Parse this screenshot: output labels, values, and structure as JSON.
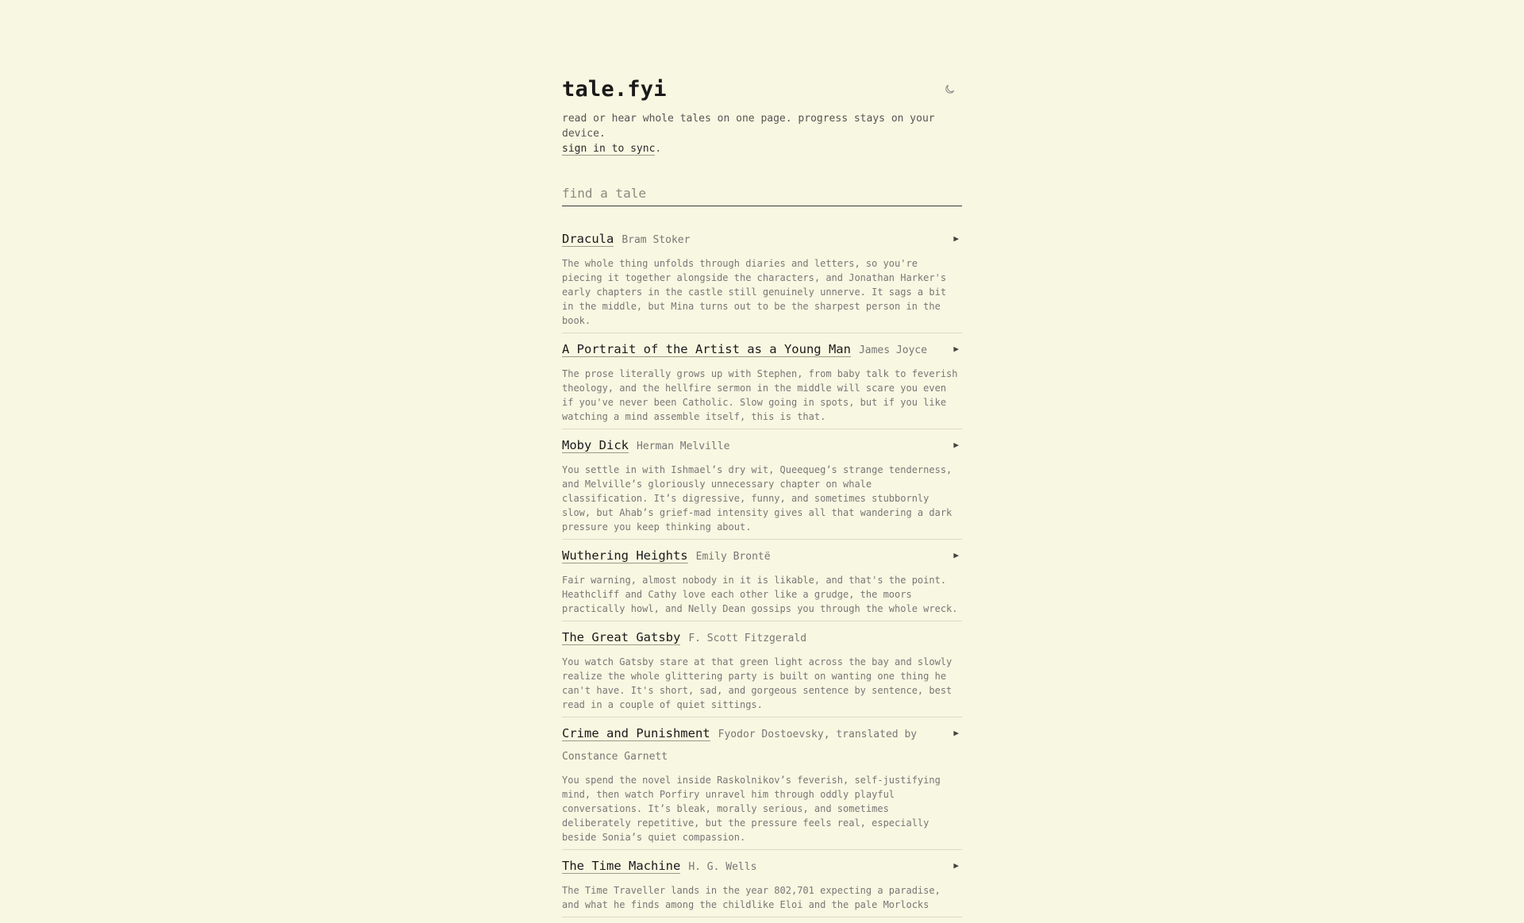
{
  "site": {
    "title": "tale.fyi",
    "tagline": "read or hear whole tales on one page. progress stays on your device.",
    "sync_link": "sign in to sync",
    "sync_suffix": "."
  },
  "theme_toggle": {
    "icon": "moon-icon"
  },
  "search": {
    "placeholder": "find a tale",
    "value": ""
  },
  "tales": [
    {
      "title": "Dracula",
      "author": "Bram Stoker",
      "play": "▶",
      "description": "The whole thing unfolds through diaries and letters, so you're piecing it together alongside the characters, and Jonathan Harker's early chapters in the castle still genuinely unnerve. It sags a bit in the middle, but Mina turns out to be the sharpest person in the book."
    },
    {
      "title": "A Portrait of the Artist as a Young Man",
      "author": "James Joyce",
      "play": "▶",
      "description": "The prose literally grows up with Stephen, from baby talk to feverish theology, and the hellfire sermon in the middle will scare you even if you've never been Catholic. Slow going in spots, but if you like watching a mind assemble itself, this is that."
    },
    {
      "title": "Moby Dick",
      "author": "Herman Melville",
      "play": "▶",
      "description": "You settle in with Ishmael’s dry wit, Queequeg’s strange tenderness, and Melville’s gloriously unnecessary chapter on whale classification. It’s digressive, funny, and sometimes stubbornly slow, but Ahab’s grief-mad intensity gives all that wandering a dark pressure you keep thinking about."
    },
    {
      "title": "Wuthering Heights",
      "author": "Emily Brontë",
      "play": "▶",
      "description": "Fair warning, almost nobody in it is likable, and that's the point. Heathcliff and Cathy love each other like a grudge, the moors practically howl, and Nelly Dean gossips you through the whole wreck."
    },
    {
      "title": "The Great Gatsby",
      "author": "F. Scott Fitzgerald",
      "play": "",
      "description": "You watch Gatsby stare at that green light across the bay and slowly realize the whole glittering party is built on wanting one thing he can't have. It's short, sad, and gorgeous sentence by sentence, best read in a couple of quiet sittings."
    },
    {
      "title": "Crime and Punishment",
      "author": "Fyodor Dostoevsky, translated by Constance Garnett",
      "play": "▶",
      "description": "You spend the novel inside Raskolnikov’s feverish, self-justifying mind, then watch Porfiry unravel him through oddly playful conversations. It’s bleak, morally serious, and sometimes deliberately repetitive, but the pressure feels real, especially beside Sonia’s quiet compassion."
    },
    {
      "title": "The Time Machine",
      "author": "H. G. Wells",
      "play": "▶",
      "description": "The Time Traveller lands in the year 802,701 expecting a paradise, and what he finds among the childlike Eloi and the pale Morlocks"
    }
  ]
}
